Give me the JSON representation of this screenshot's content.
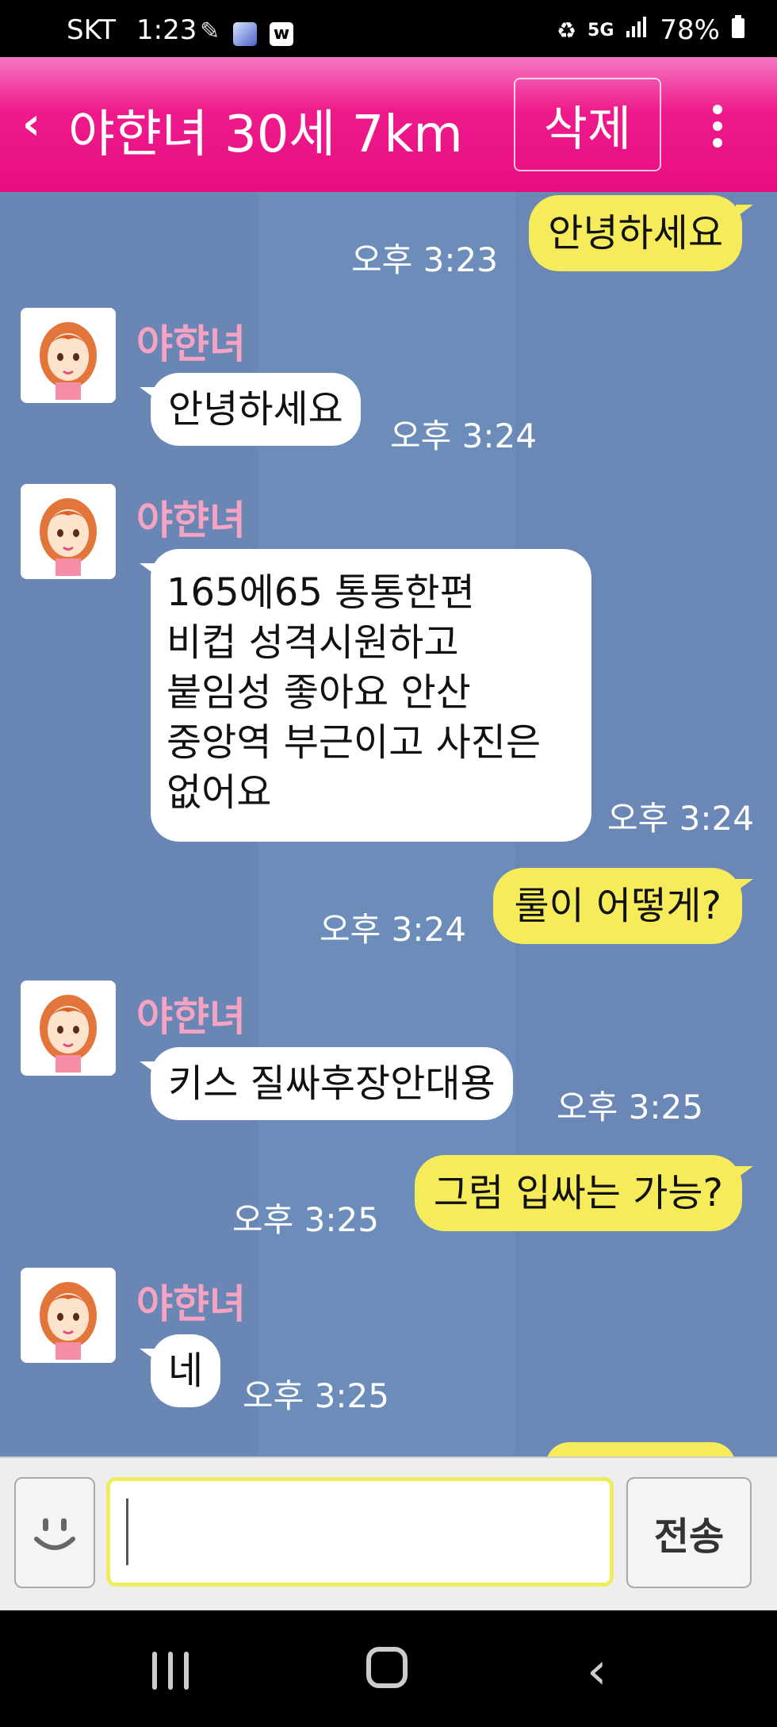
{
  "status_bar": {
    "carrier": "SKT",
    "time": "1:23",
    "network": "5G",
    "battery": "78%"
  },
  "header": {
    "title": "야햔녀 30세 7km",
    "delete_label": "삭제"
  },
  "chat": {
    "contact_name": "야햔녀",
    "messages": [
      {
        "from": "me",
        "text": "안녕하세요",
        "time": "오후 3:23"
      },
      {
        "from": "them",
        "text": "안녕하세요",
        "time": "오후 3:24"
      },
      {
        "from": "them",
        "lines": [
          "165에65 통통한편",
          "비컵 성격시원하고",
          "붙임성 좋아요 안산",
          "중앙역 부근이고 사진은",
          "없어요"
        ],
        "time": "오후 3:24"
      },
      {
        "from": "me",
        "text": "룰이 어떻게?",
        "time": "오후 3:24"
      },
      {
        "from": "them",
        "text": "키스 질싸후장안대용",
        "time": "오후 3:25"
      },
      {
        "from": "me",
        "text": "그럼 입싸는 가능?",
        "time": "오후 3:25"
      },
      {
        "from": "them",
        "text": "네",
        "time": "오후 3:25"
      }
    ]
  },
  "input_bar": {
    "message_value": "",
    "send_label": "전송"
  },
  "colors": {
    "header_pink": "#ee1a8b",
    "chat_background": "#6a86b4",
    "my_bubble": "#f6ec5b",
    "their_bubble": "#ffffff",
    "sender_name": "#f5a3c2"
  }
}
